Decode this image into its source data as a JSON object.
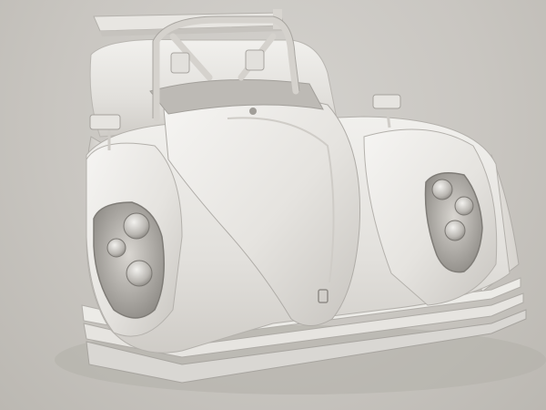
{
  "scene": {
    "subject": "race-car-3d-model",
    "render_style": "untextured clay render",
    "colors": {
      "background": "#c9c6c1",
      "body": "#e4e2de",
      "body_highlight": "#f4f3f1",
      "body_shadow": "#a9a6a1",
      "lamp_recess": "#8e8b86",
      "floor_shadow": "#b3b0aa"
    }
  }
}
